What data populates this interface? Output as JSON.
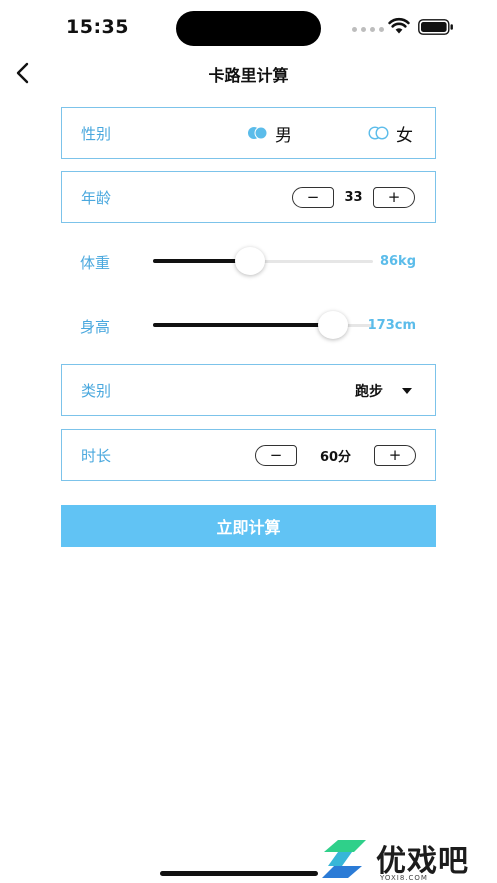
{
  "status_bar": {
    "time": "15:35",
    "icons": [
      "signal-dots-icon",
      "wifi-icon",
      "battery-icon"
    ]
  },
  "nav": {
    "title": "卡路里计算",
    "back_icon": "chevron-left-icon"
  },
  "gender": {
    "label": "性别",
    "options": [
      {
        "label": "男",
        "selected": true
      },
      {
        "label": "女",
        "selected": false
      }
    ]
  },
  "age": {
    "label": "年龄",
    "value": "33",
    "minus": "−",
    "plus": "+"
  },
  "weight": {
    "label": "体重",
    "value_text": "86kg",
    "fraction": 0.44
  },
  "height": {
    "label": "身高",
    "value_text": "173cm",
    "fraction": 0.82
  },
  "category": {
    "label": "类别",
    "value": "跑步"
  },
  "duration": {
    "label": "时长",
    "value": "60分",
    "minus": "−",
    "plus": "+"
  },
  "action": {
    "calculate_label": "立即计算"
  },
  "watermark": {
    "text": "优戏吧",
    "sub": "YOXI8.COM"
  },
  "colors": {
    "accent": "#61c3f4",
    "label": "#4aa8de",
    "border": "#7cc3ea",
    "slider_value": "#5bbcea",
    "radio_on": "#5bbcea"
  }
}
